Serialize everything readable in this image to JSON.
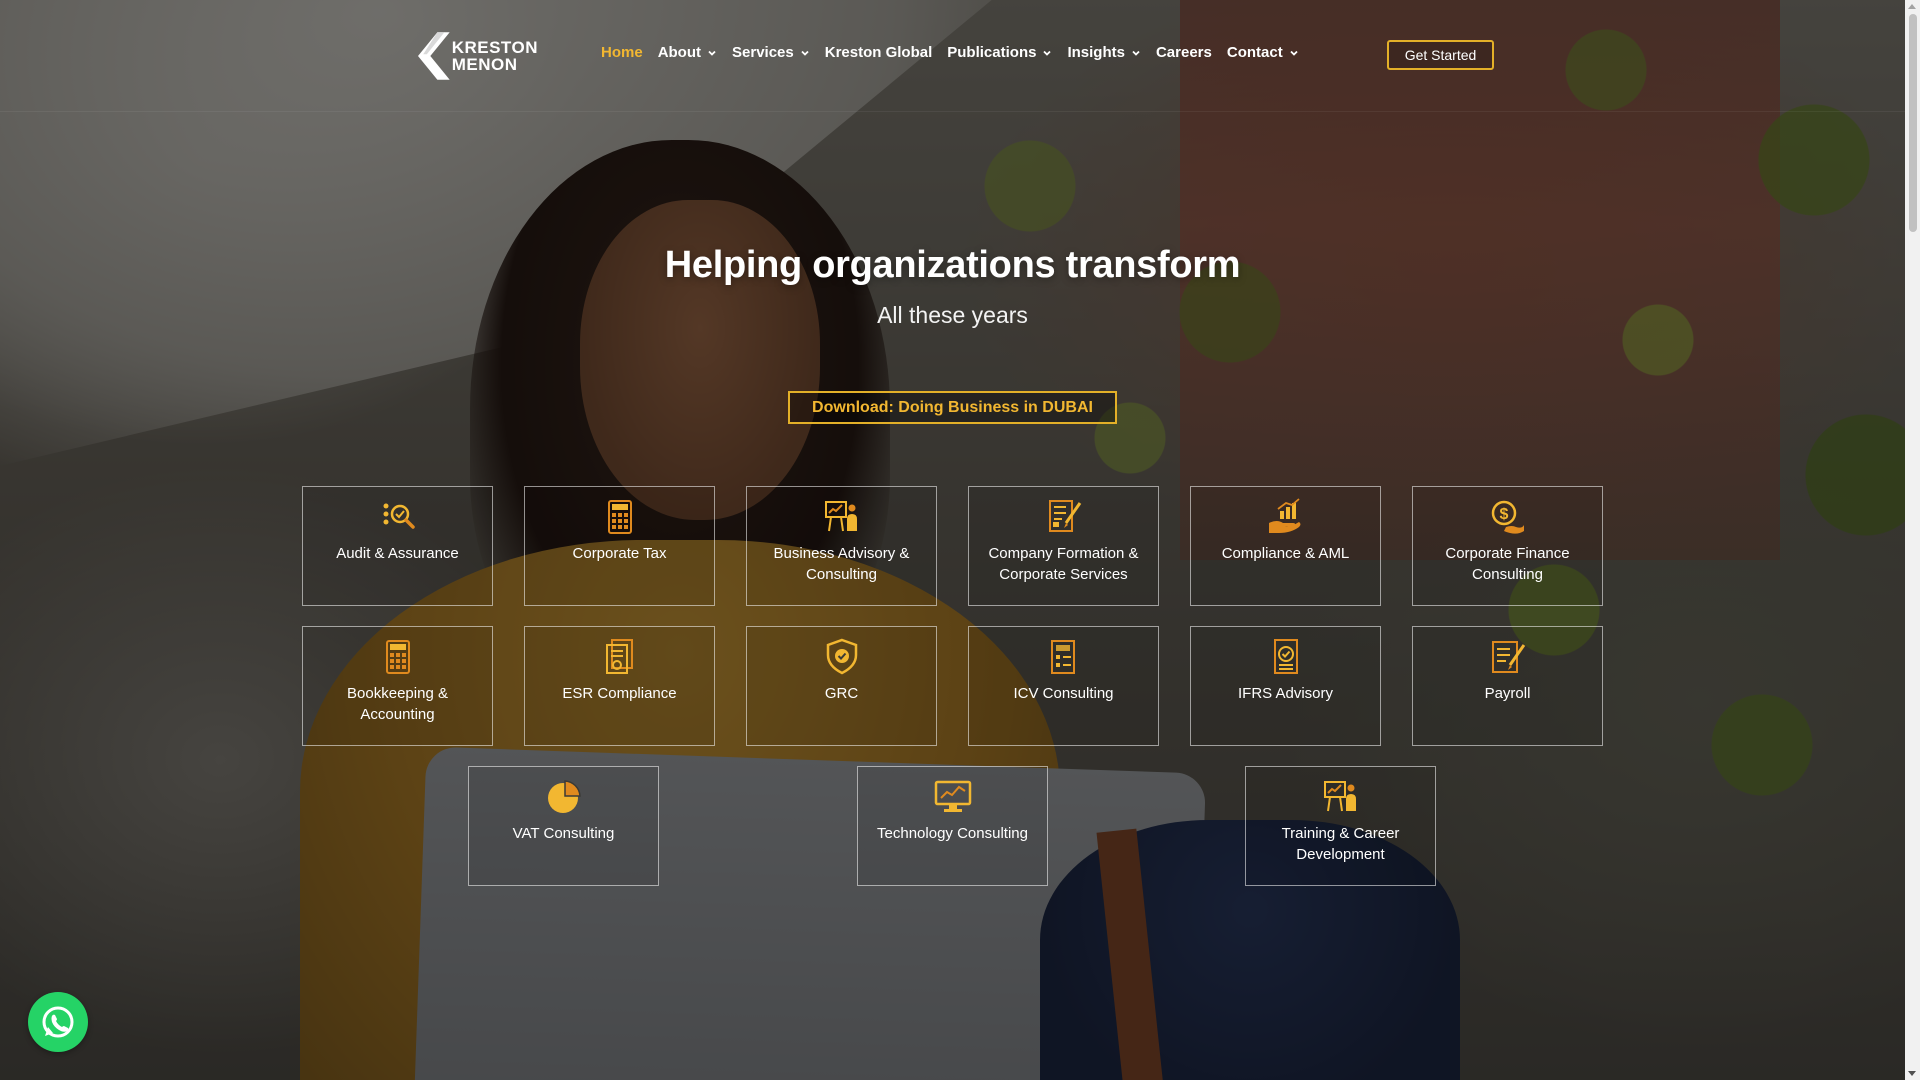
{
  "brand": {
    "logo_line1": "KRESTON",
    "logo_line2": "MENON",
    "accent_color": "#f2b731",
    "whatsapp_color": "#25d366"
  },
  "nav": {
    "items": [
      {
        "label": "Home",
        "active": true,
        "dropdown": false
      },
      {
        "label": "About",
        "active": false,
        "dropdown": true
      },
      {
        "label": "Services",
        "active": false,
        "dropdown": true
      },
      {
        "label": "Kreston Global",
        "active": false,
        "dropdown": false
      },
      {
        "label": "Publications",
        "active": false,
        "dropdown": true
      },
      {
        "label": "Insights",
        "active": false,
        "dropdown": true
      },
      {
        "label": "Careers",
        "active": false,
        "dropdown": false
      },
      {
        "label": "Contact",
        "active": false,
        "dropdown": true
      }
    ],
    "cta": "Get Started"
  },
  "hero": {
    "title": "Helping organizations transform",
    "subtitle": "All these years",
    "download": "Download: Doing Business in DUBAI"
  },
  "services": [
    {
      "label": "Audit & Assurance",
      "icon": "audit-search-icon"
    },
    {
      "label": "Corporate Tax",
      "icon": "calculator-icon"
    },
    {
      "label": "Business Advisory & Consulting",
      "icon": "presentation-icon"
    },
    {
      "label": "Company Formation & Corporate Services",
      "icon": "document-edit-icon"
    },
    {
      "label": "Compliance & AML",
      "icon": "chart-hand-icon"
    },
    {
      "label": "Corporate Finance Consulting",
      "icon": "dollar-coin-icon"
    },
    {
      "label": "Bookkeeping & Accounting",
      "icon": "calculator-icon"
    },
    {
      "label": "ESR Compliance",
      "icon": "report-document-icon"
    },
    {
      "label": "GRC",
      "icon": "shield-check-icon"
    },
    {
      "label": "ICV Consulting",
      "icon": "checklist-document-icon"
    },
    {
      "label": "IFRS Advisory",
      "icon": "checklist-icon"
    },
    {
      "label": "Payroll",
      "icon": "document-pen-icon"
    },
    {
      "label": "VAT Consulting",
      "icon": "pie-chart-icon"
    },
    {
      "label": "Technology Consulting",
      "icon": "monitor-icon"
    },
    {
      "label": "Training & Career Development",
      "icon": "presentation-icon"
    }
  ]
}
